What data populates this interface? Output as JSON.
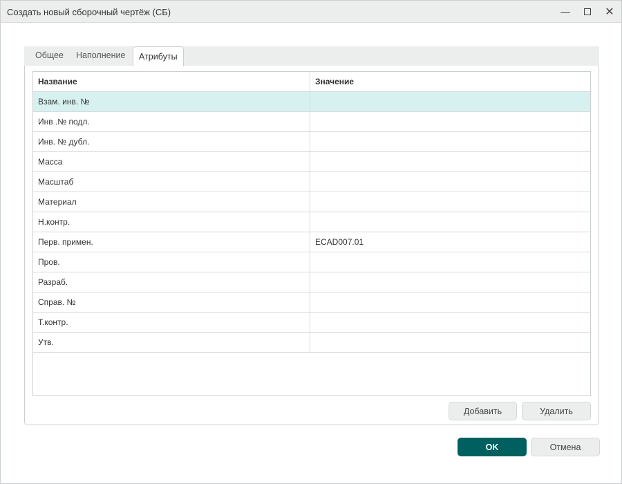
{
  "window": {
    "title": "Создать новый сборочный чертёж (СБ)",
    "controls": [
      "minimize-icon",
      "maximize-icon",
      "close-icon"
    ]
  },
  "tabs": [
    {
      "label": "Общее"
    },
    {
      "label": "Наполнение"
    },
    {
      "label": "Атрибуты",
      "active": true
    }
  ],
  "table": {
    "headers": [
      "Название",
      "Значение"
    ],
    "rows": [
      {
        "name": "Взам. инв. №",
        "value": ""
      },
      {
        "name": "Инв .№ подл.",
        "value": ""
      },
      {
        "name": "Инв. № дубл.",
        "value": ""
      },
      {
        "name": "Масса",
        "value": ""
      },
      {
        "name": "Масштаб",
        "value": ""
      },
      {
        "name": "Материал",
        "value": ""
      },
      {
        "name": "Н.контр.",
        "value": ""
      },
      {
        "name": "Перв. примен.",
        "value": "ECAD007.01"
      },
      {
        "name": "Пров.",
        "value": ""
      },
      {
        "name": "Разраб.",
        "value": ""
      },
      {
        "name": "Справ. №",
        "value": ""
      },
      {
        "name": "Т.контр.",
        "value": ""
      },
      {
        "name": "Утв.",
        "value": ""
      }
    ],
    "selected_row": 0
  },
  "buttons": {
    "add": "Добавить",
    "delete": "Удалить",
    "ok": "OK",
    "cancel": "Отмена"
  },
  "colors": {
    "accent": "#006060",
    "selection": "#d7f1f1"
  }
}
